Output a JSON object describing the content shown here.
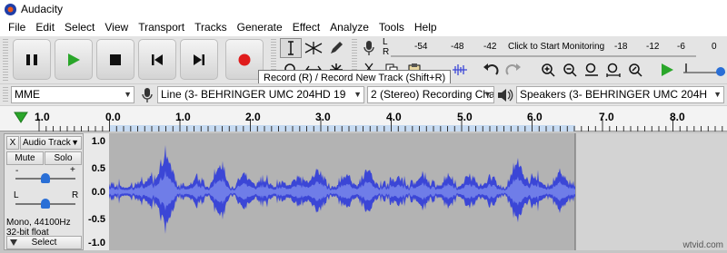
{
  "window": {
    "title": "Audacity"
  },
  "menu": [
    "File",
    "Edit",
    "Select",
    "View",
    "Transport",
    "Tracks",
    "Generate",
    "Effect",
    "Analyze",
    "Tools",
    "Help"
  ],
  "transport": {
    "pause_icon": "pause-icon",
    "play_icon": "play-icon",
    "stop_icon": "stop-icon",
    "skip_start_icon": "skip-start-icon",
    "skip_end_icon": "skip-end-icon",
    "record_icon": "record-icon"
  },
  "meter": {
    "rec_channels": [
      "L",
      "R"
    ],
    "monitor_label": "Click to Start Monitoring",
    "scale": [
      "-54",
      "-48",
      "-42",
      "-18",
      "-12",
      "-6",
      "0"
    ]
  },
  "devices": {
    "host": "MME",
    "recording_device": "Line (3- BEHRINGER UMC 204HD 19",
    "channels": "2 (Stereo) Recording Chai",
    "playback_device": "Speakers (3- BEHRINGER UMC 204H"
  },
  "timeline": {
    "ticks": [
      "1.0",
      "0.0",
      "1.0",
      "2.0",
      "3.0",
      "4.0",
      "5.0",
      "6.0",
      "7.0",
      "8.0"
    ]
  },
  "track": {
    "name": "Audio Track",
    "close": "X",
    "mute_label": "Mute",
    "solo_label": "Solo",
    "gain_minus": "-",
    "gain_plus": "+",
    "pan_left": "L",
    "pan_right": "R",
    "info_line1": "Mono, 44100Hz",
    "info_line2": "32-bit float",
    "select_label": "Select",
    "ruler_labels": [
      "1.0",
      "0.5",
      "0.0",
      "-0.5",
      "-1.0"
    ],
    "duration_seconds": 6.6
  },
  "tooltip": "Record (R) / Record New Track (Shift+R)",
  "watermark": "wtvid.com",
  "colors": {
    "record_red": "#e01b1b",
    "play_green": "#2aa62a",
    "wave_blue": "#3b46d6",
    "selection_gray": "#b3b3b3"
  }
}
